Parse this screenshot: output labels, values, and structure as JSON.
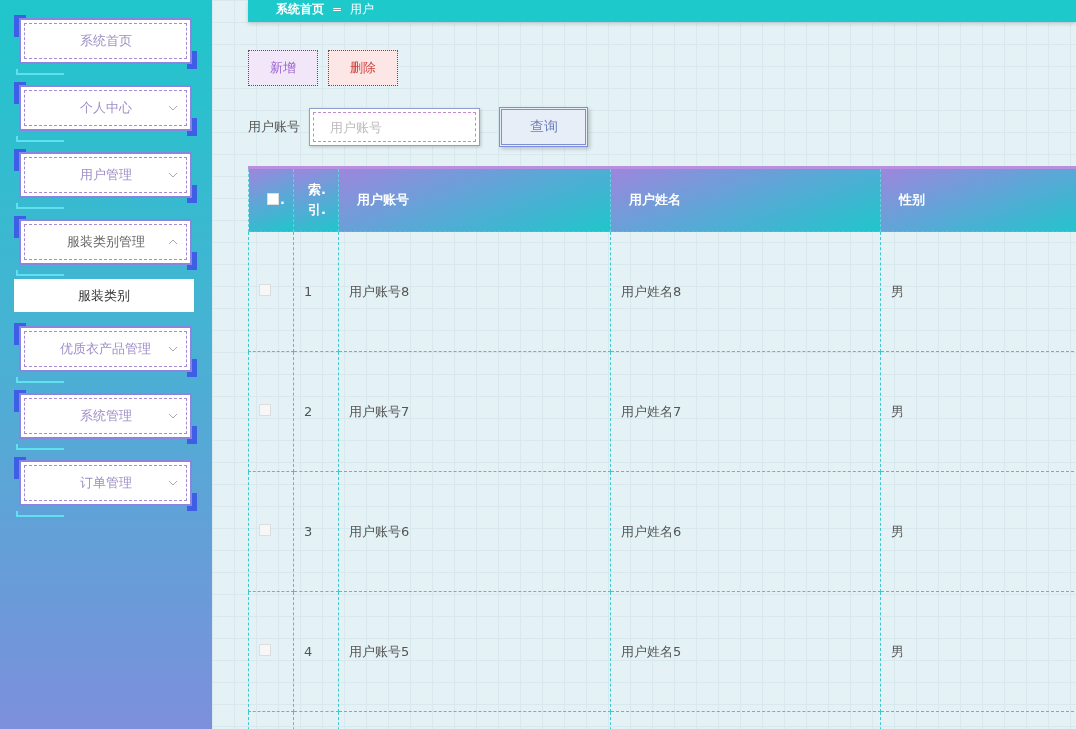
{
  "sidebar": {
    "items": [
      {
        "label": "系统首页",
        "kind": "link"
      },
      {
        "label": "个人中心",
        "kind": "menu",
        "expanded": false
      },
      {
        "label": "用户管理",
        "kind": "menu",
        "expanded": false
      },
      {
        "label": "服装类别管理",
        "kind": "menu",
        "expanded": true,
        "children": [
          {
            "label": "服装类别"
          }
        ]
      },
      {
        "label": "优质衣产品管理",
        "kind": "menu",
        "expanded": false
      },
      {
        "label": "系统管理",
        "kind": "menu",
        "expanded": false
      },
      {
        "label": "订单管理",
        "kind": "menu",
        "expanded": false
      }
    ]
  },
  "breadcrumb": {
    "items": [
      "系统首页",
      "用户"
    ],
    "separator": "="
  },
  "actions": [
    {
      "label": "新增",
      "kind": "add"
    },
    {
      "label": "删除",
      "kind": "delete"
    }
  ],
  "search": {
    "label": "用户账号",
    "placeholder": "用户账号",
    "button": "查询"
  },
  "table": {
    "select_all": {
      "checked": false,
      "label": "."
    },
    "columns": [
      "索.引.",
      "用户账号",
      "用户姓名",
      "性别"
    ],
    "rows": [
      {
        "checked": false,
        "cells": [
          "1",
          "用户账号8",
          "用户姓名8",
          "男"
        ]
      },
      {
        "checked": false,
        "cells": [
          "2",
          "用户账号7",
          "用户姓名7",
          "男"
        ]
      },
      {
        "checked": false,
        "cells": [
          "3",
          "用户账号6",
          "用户姓名6",
          "男"
        ]
      },
      {
        "checked": false,
        "cells": [
          "4",
          "用户账号5",
          "用户姓名5",
          "男"
        ]
      }
    ]
  }
}
